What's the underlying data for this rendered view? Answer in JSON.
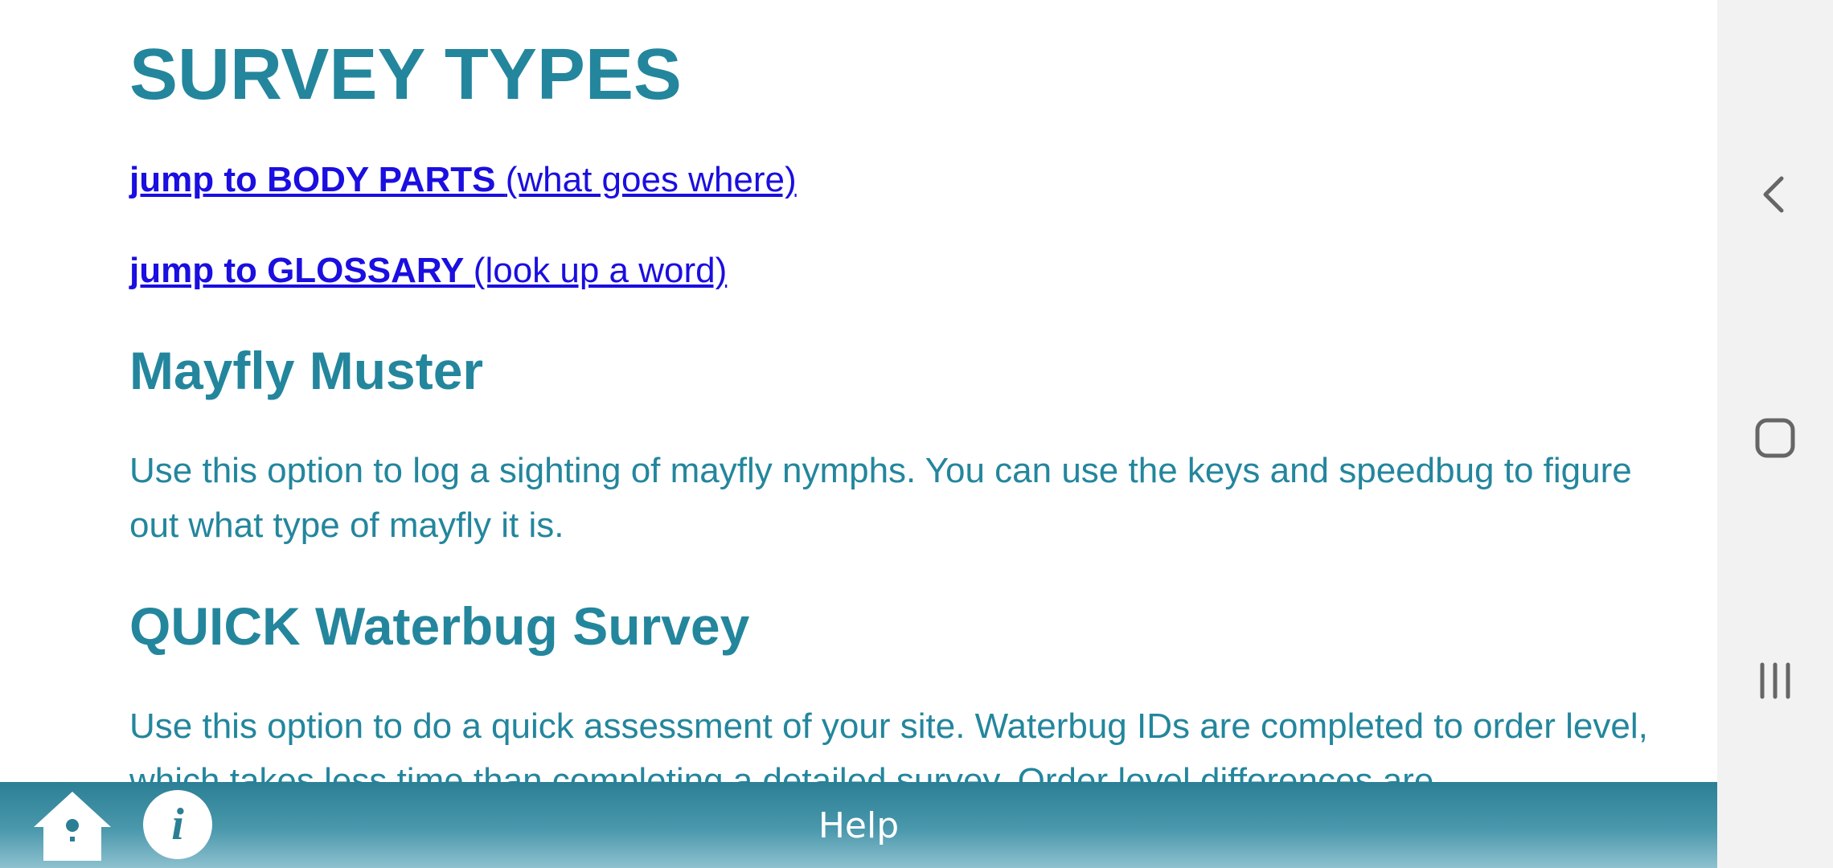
{
  "content": {
    "title": "SURVEY TYPES",
    "links": [
      {
        "bold": "jump to BODY PARTS ",
        "normal": "(what goes where)"
      },
      {
        "bold": "jump to GLOSSARY ",
        "normal": "(look up a word)"
      }
    ],
    "sections": [
      {
        "heading": "Mayfly Muster",
        "text": "Use this option to log a sighting of mayfly nymphs. You can use the keys and speedbug to figure out what type of mayfly it is."
      },
      {
        "heading": "QUICK Waterbug Survey",
        "text": "Use this option to do a quick assessment of your site. Waterbug IDs are completed to order level, which takes less time than completing a detailed survey. Order level differences are"
      }
    ]
  },
  "toolbar": {
    "title": "Help",
    "home_icon": "home-birdhouse-icon",
    "info_icon": "info-icon",
    "info_glyph": "i"
  },
  "navbar": {
    "back_icon": "back-chevron-icon",
    "home_icon": "home-square-icon",
    "recents_icon": "recents-lines-icon"
  },
  "colors": {
    "heading": "#23869d",
    "link": "#1a0ee0",
    "toolbar_top": "#2b7f95",
    "toolbar_bottom": "#8ec1cf",
    "navbar_bg": "#f2f2f2",
    "navbar_icon": "#666666"
  }
}
